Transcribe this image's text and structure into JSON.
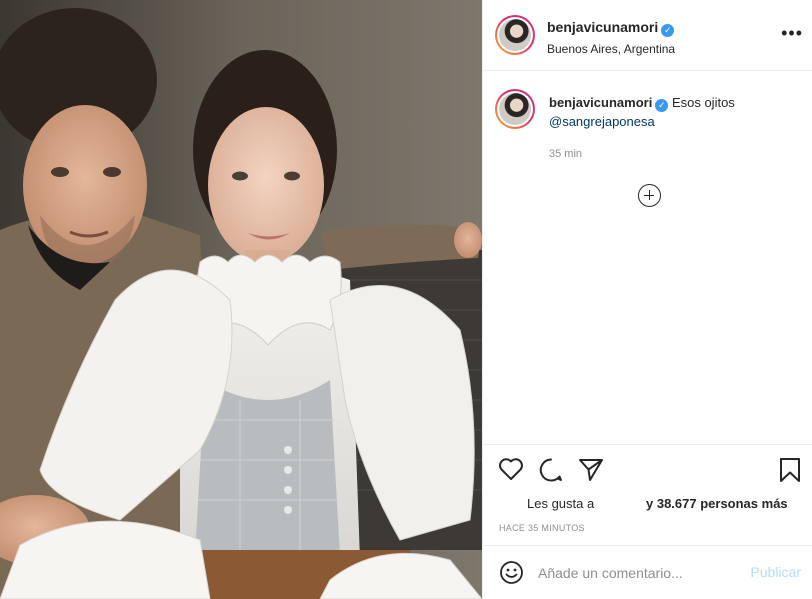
{
  "post": {
    "username": "benjavicunamori",
    "location": "Buenos Aires, Argentina",
    "caption": {
      "username": "benjavicunamori",
      "text": "Esos ojitos",
      "mention": "@sangrejaponesa",
      "time": "35 min"
    },
    "likes": {
      "prefix": "Les gusta a",
      "suffix": "y 38.677 personas más"
    },
    "posted_ago": "HACE 35 MINUTOS",
    "comment": {
      "placeholder": "Añade un comentario...",
      "publish_label": "Publicar"
    }
  },
  "icons": {
    "more": "more-options-icon",
    "verified": "verified-badge-icon",
    "load_more": "plus-circle-icon",
    "like": "heart-icon",
    "comment": "comment-icon",
    "share": "send-icon",
    "save": "bookmark-icon",
    "emoji": "emoji-icon"
  },
  "colors": {
    "verified": "#3897f0",
    "mention": "#00376b",
    "publish_disabled": "#b2dffc",
    "muted_text": "#8e8e8e"
  }
}
